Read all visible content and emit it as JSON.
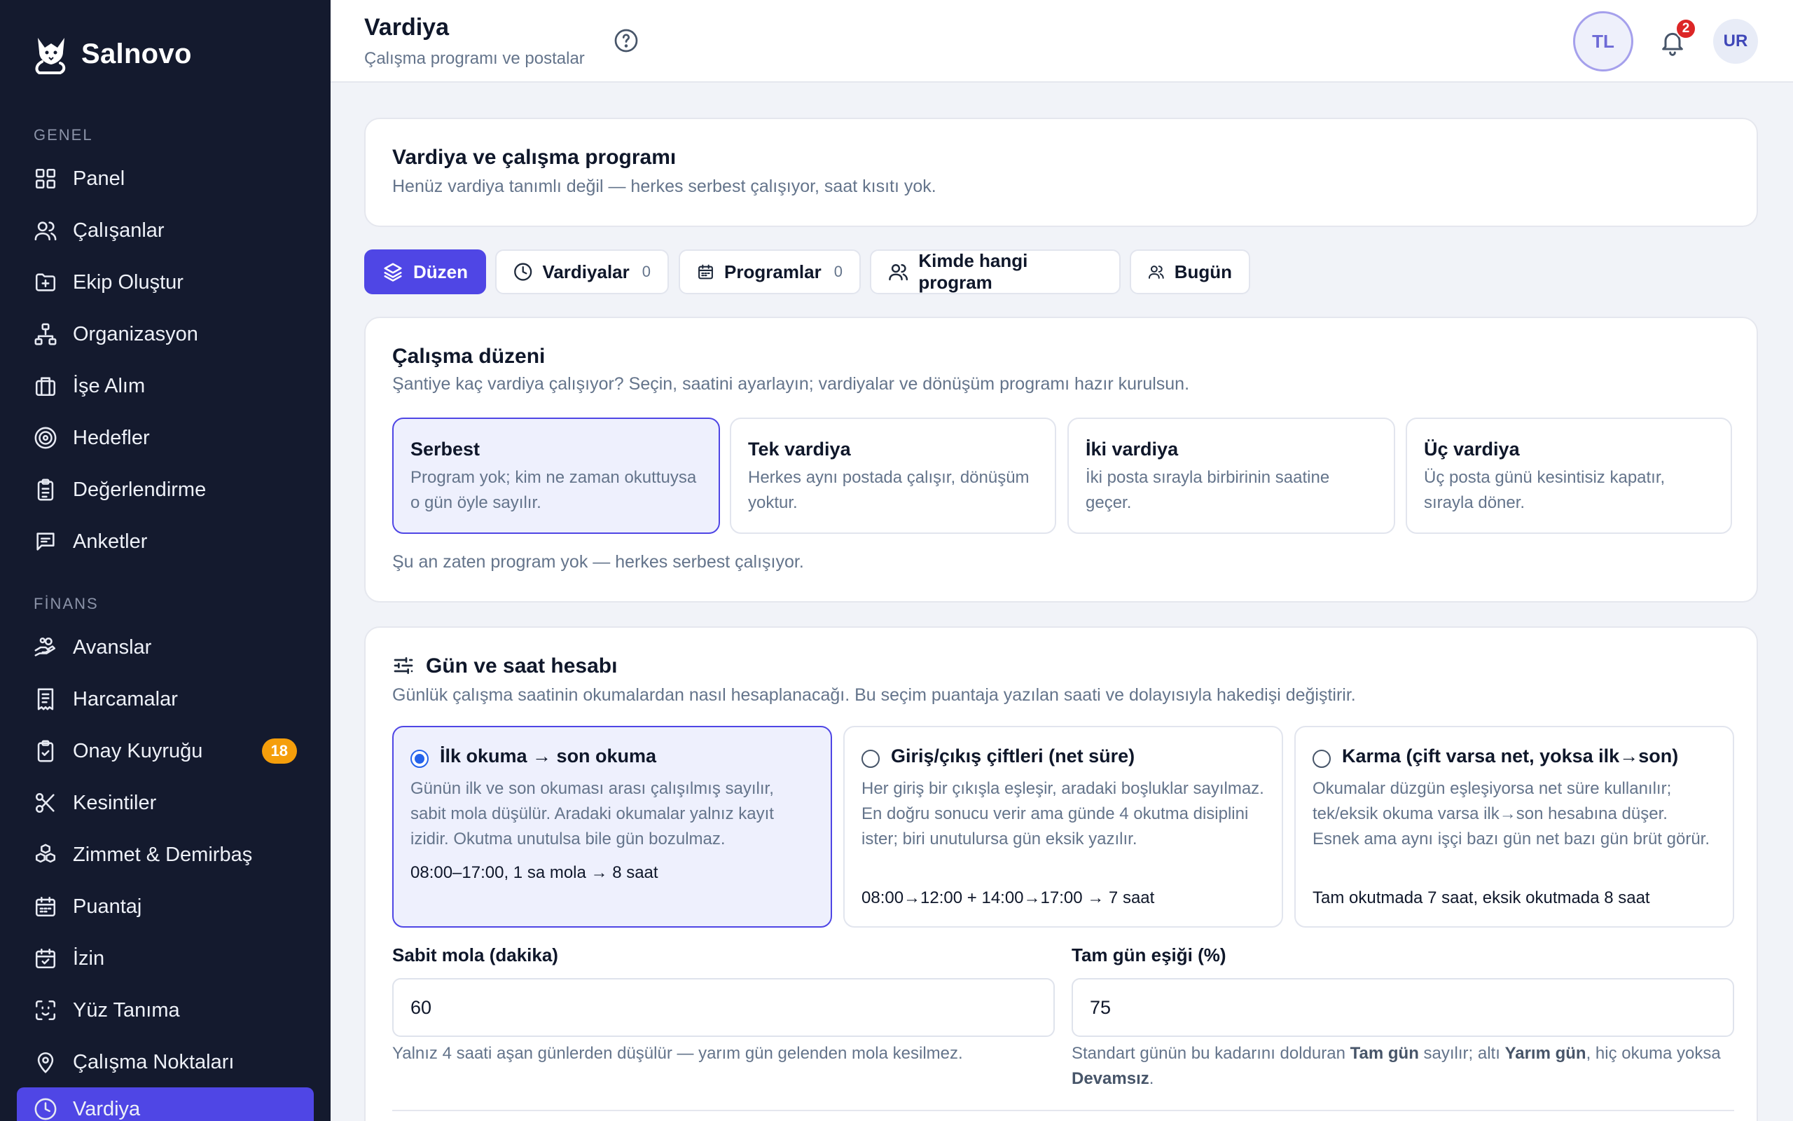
{
  "brand": {
    "name": "Salnovo"
  },
  "sidebar": {
    "section_general": "GENEL",
    "section_finance": "FİNANS",
    "general_items": [
      {
        "label": "Panel",
        "icon": "grid-icon"
      },
      {
        "label": "Çalışanlar",
        "icon": "users-icon"
      },
      {
        "label": "Ekip Oluştur",
        "icon": "folder-plus-icon"
      },
      {
        "label": "Organizasyon",
        "icon": "org-chart-icon"
      },
      {
        "label": "İşe Alım",
        "icon": "briefcase-icon"
      },
      {
        "label": "Hedefler",
        "icon": "target-icon"
      },
      {
        "label": "Değerlendirme",
        "icon": "clipboard-icon"
      },
      {
        "label": "Anketler",
        "icon": "message-icon"
      }
    ],
    "finance_items": [
      {
        "label": "Avanslar",
        "icon": "hand-coins-icon"
      },
      {
        "label": "Harcamalar",
        "icon": "receipt-icon"
      },
      {
        "label": "Onay Kuyruğu",
        "icon": "clipboard-check-icon",
        "badge": "18"
      },
      {
        "label": "Kesintiler",
        "icon": "scissors-icon"
      },
      {
        "label": "Zimmet & Demirbaş",
        "icon": "boxes-icon"
      },
      {
        "label": "Puantaj",
        "icon": "calendar-grid-icon"
      },
      {
        "label": "İzin",
        "icon": "calendar-check-icon"
      },
      {
        "label": "Yüz Tanıma",
        "icon": "face-scan-icon"
      },
      {
        "label": "Çalışma Noktaları",
        "icon": "map-pin-icon"
      },
      {
        "label": "Vardiya",
        "icon": "clock-icon",
        "active": true
      }
    ]
  },
  "header": {
    "title": "Vardiya",
    "subtitle": "Çalışma programı ve postalar",
    "tenant_initials": "TL",
    "notification_count": "2",
    "user_initials": "UR"
  },
  "intro": {
    "title": "Vardiya ve çalışma programı",
    "subtitle": "Henüz vardiya tanımlı değil — herkes serbest çalışıyor, saat kısıtı yok."
  },
  "tabs": [
    {
      "label": "Düzen",
      "icon": "layers-icon",
      "active": true
    },
    {
      "label": "Vardiyalar",
      "icon": "clock-icon",
      "count": "0"
    },
    {
      "label": "Programlar",
      "icon": "calendar-icon",
      "count": "0"
    },
    {
      "label": "Kimde hangi program",
      "icon": "users-icon"
    },
    {
      "label": "Bugün",
      "icon": "users-icon"
    }
  ],
  "work_order": {
    "title": "Çalışma düzeni",
    "subtitle": "Şantiye kaç vardiya çalışıyor? Seçin, saatini ayarlayın; vardiyalar ve dönüşüm programı hazır kurulsun.",
    "options": [
      {
        "title": "Serbest",
        "desc": "Program yok; kim ne zaman okuttuysa o gün öyle sayılır.",
        "selected": true
      },
      {
        "title": "Tek vardiya",
        "desc": "Herkes aynı postada çalışır, dönüşüm yoktur."
      },
      {
        "title": "İki vardiya",
        "desc": "İki posta sırayla birbirinin saatine geçer."
      },
      {
        "title": "Üç vardiya",
        "desc": "Üç posta günü kesintisiz kapatır, sırayla döner."
      }
    ],
    "status": "Şu an zaten program yok — herkes serbest çalışıyor."
  },
  "hours_calc": {
    "title": "Gün ve saat hesabı",
    "icon": "sliders-icon",
    "subtitle": "Günlük çalışma saatinin okumalardan nasıl hesaplanacağı. Bu seçim puantaja yazılan saati ve dolayısıyla hakedişi değiştirir.",
    "methods": [
      {
        "title": "İlk okuma → son okuma",
        "desc": "Günün ilk ve son okuması arası çalışılmış sayılır, sabit mola düşülür. Aradaki okumalar yalnız kayıt izidir. Okutma unutulsa bile gün bozulmaz.",
        "example": "08:00–17:00, 1 sa mola → 8 saat",
        "selected": true
      },
      {
        "title": "Giriş/çıkış çiftleri (net süre)",
        "desc": "Her giriş bir çıkışla eşleşir, aradaki boşluklar sayılmaz. En doğru sonucu verir ama günde 4 okutma disiplini ister; biri unutulursa gün eksik yazılır.",
        "example": "08:00→12:00 + 14:00→17:00 → 7 saat"
      },
      {
        "title": "Karma (çift varsa net, yoksa ilk→son)",
        "desc": "Okumalar düzgün eşleşiyorsa net süre kullanılır; tek/eksik okuma varsa ilk→son hesabına düşer. Esnek ama aynı işçi bazı gün net bazı gün brüt görür.",
        "example": "Tam okutmada 7 saat, eksik okutmada 8 saat"
      }
    ],
    "break_label": "Sabit mola (dakika)",
    "break_value": "60",
    "break_help": "Yalnız 4 saati aşan günlerden düşülür — yarım gün gelenden mola kesilmez.",
    "threshold_label": "Tam gün eşiği (%)",
    "threshold_value": "75",
    "threshold_help_1": "Standart günün bu kadarını dolduran ",
    "threshold_help_full": "Tam gün",
    "threshold_help_2": " sayılır; altı ",
    "threshold_help_half": "Yarım gün",
    "threshold_help_3": ", hiç okuma yoksa ",
    "threshold_help_absent": "Devamsız",
    "threshold_help_4": "."
  },
  "colors": {
    "accent": "#4f46e5",
    "sidebar_bg": "#141a2e",
    "badge": "#f59e0b",
    "notification": "#dc2626"
  }
}
